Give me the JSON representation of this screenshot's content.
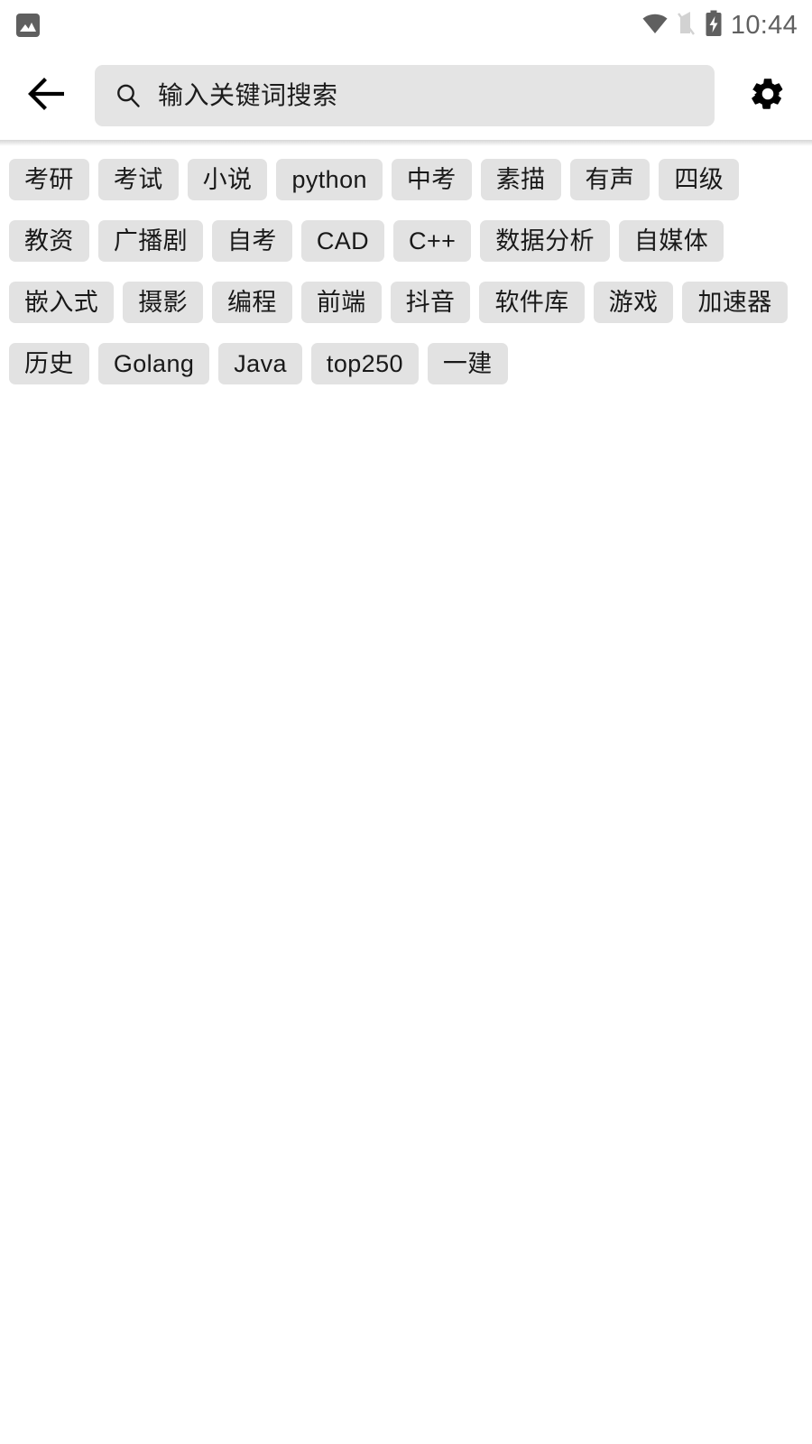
{
  "status_bar": {
    "notification_icon": "image-icon",
    "wifi_icon": "wifi-icon",
    "signal_off_icon": "signal-off-icon",
    "battery_charging_icon": "battery-charging-icon",
    "time": "10:44",
    "icon_color": "#5f5f5f",
    "time_color": "#606060"
  },
  "header": {
    "back_icon": "arrow-left-icon",
    "search": {
      "icon": "search-icon",
      "placeholder": "输入关键词搜索",
      "value": "",
      "background": "#e4e4e4"
    },
    "settings_icon": "gear-icon"
  },
  "tags": {
    "chip_background": "#e2e2e2",
    "chip_text_color": "#191919",
    "items": [
      {
        "label": "考研"
      },
      {
        "label": "考试"
      },
      {
        "label": "小说"
      },
      {
        "label": "python"
      },
      {
        "label": "中考"
      },
      {
        "label": "素描"
      },
      {
        "label": "有声"
      },
      {
        "label": "四级"
      },
      {
        "label": "教资"
      },
      {
        "label": "广播剧"
      },
      {
        "label": "自考"
      },
      {
        "label": "CAD"
      },
      {
        "label": "C++"
      },
      {
        "label": "数据分析"
      },
      {
        "label": "自媒体"
      },
      {
        "label": "嵌入式"
      },
      {
        "label": "摄影"
      },
      {
        "label": "编程"
      },
      {
        "label": "前端"
      },
      {
        "label": "抖音"
      },
      {
        "label": "软件库"
      },
      {
        "label": "游戏"
      },
      {
        "label": "加速器"
      },
      {
        "label": "历史"
      },
      {
        "label": "Golang"
      },
      {
        "label": "Java"
      },
      {
        "label": "top250"
      },
      {
        "label": "一建"
      }
    ]
  }
}
